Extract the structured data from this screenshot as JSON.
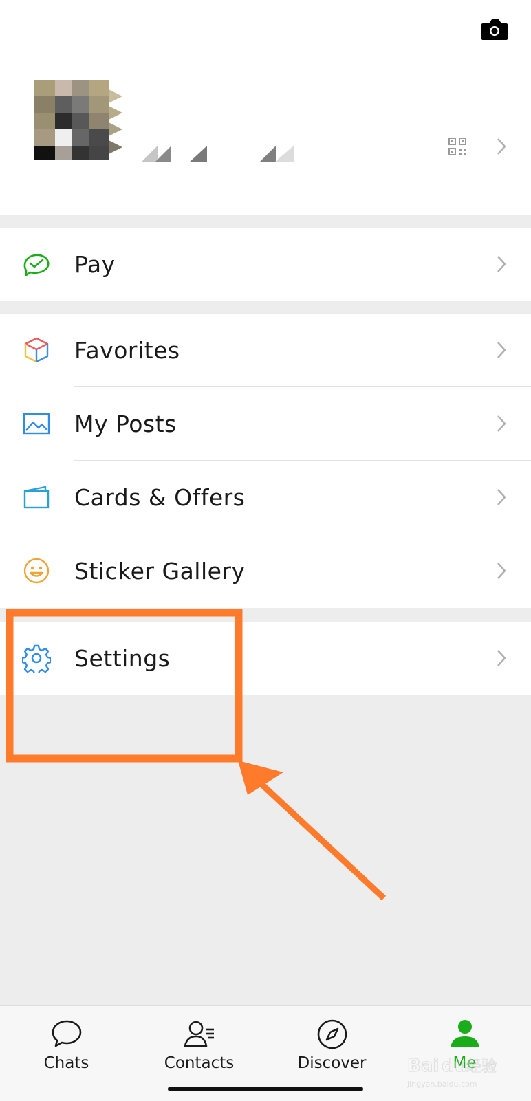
{
  "profile": {
    "camera_icon": "camera-icon",
    "qr_icon": "qr-code-icon",
    "chevron_icon": "chevron-right-icon",
    "nickname": ""
  },
  "menu": {
    "pay": {
      "label": "Pay",
      "icon": "pay-icon"
    },
    "favorites": {
      "label": "Favorites",
      "icon": "cube-icon"
    },
    "my_posts": {
      "label": "My Posts",
      "icon": "image-icon"
    },
    "cards_offers": {
      "label": "Cards & Offers",
      "icon": "card-icon"
    },
    "sticker_gallery": {
      "label": "Sticker Gallery",
      "icon": "smiley-icon"
    },
    "settings": {
      "label": "Settings",
      "icon": "gear-icon"
    }
  },
  "tabbar": {
    "chats": "Chats",
    "contacts": "Contacts",
    "discover": "Discover",
    "me": "Me"
  },
  "colors": {
    "accent_green": "#1aad19",
    "annotation_orange": "#ff7a2b",
    "settings_icon_blue": "#2f8ce8"
  },
  "watermark": "Baidu经验 jingyan.baidu.com"
}
